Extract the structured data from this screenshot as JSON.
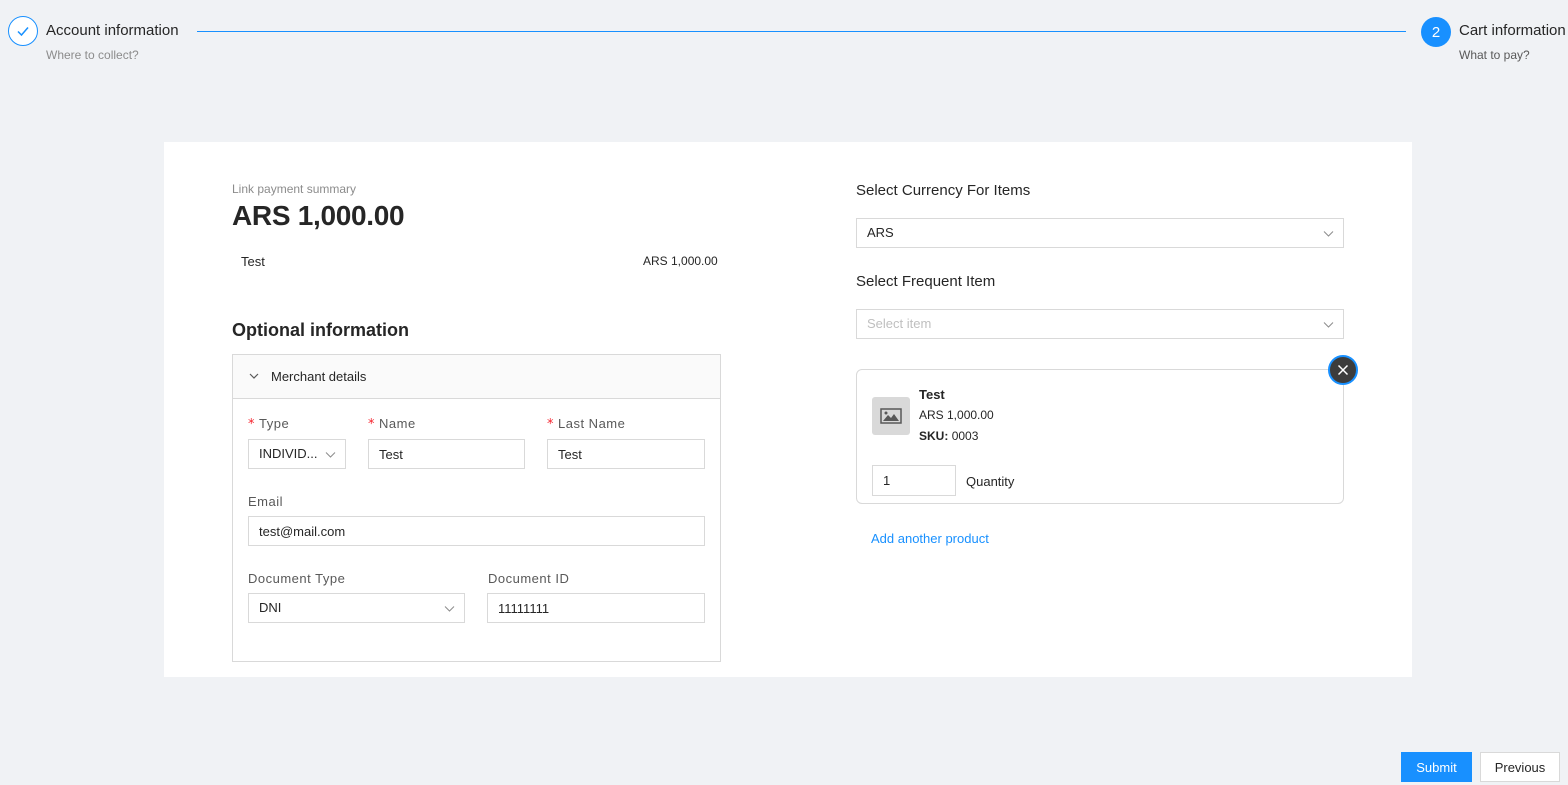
{
  "steps": [
    {
      "title": "Account information",
      "description": "Where to collect?",
      "status": "finished"
    },
    {
      "number": "2",
      "title": "Cart information",
      "description": "What to pay?",
      "status": "current"
    }
  ],
  "summary": {
    "label": "Link payment summary",
    "total": "ARS 1,000.00",
    "items": [
      {
        "name": "Test",
        "price": "ARS 1,000.00"
      }
    ]
  },
  "optional": {
    "title": "Optional information",
    "panel_title": "Merchant details",
    "fields": {
      "type": {
        "label": "Type",
        "value": "INDIVID..."
      },
      "name": {
        "label": "Name",
        "value": "Test"
      },
      "last_name": {
        "label": "Last Name",
        "value": "Test"
      },
      "email": {
        "label": "Email",
        "value": "test@mail.com"
      },
      "document_type": {
        "label": "Document Type",
        "value": "DNI"
      },
      "document_id": {
        "label": "Document ID",
        "value": "11111111"
      }
    }
  },
  "cart": {
    "currency_label": "Select Currency For Items",
    "currency_value": "ARS",
    "frequent_label": "Select Frequent Item",
    "frequent_placeholder": "Select item",
    "product": {
      "name": "Test",
      "price": "ARS 1,000.00",
      "sku_label": "SKU:",
      "sku_value": "0003",
      "quantity": "1",
      "quantity_label": "Quantity"
    },
    "add_product_label": "Add another product"
  },
  "footer": {
    "submit_label": "Submit",
    "previous_label": "Previous"
  },
  "colors": {
    "primary": "#1890ff",
    "required": "#f5222d",
    "background": "#f0f2f5"
  },
  "icons": {
    "step1": "check-icon",
    "collapse": "chevron-down-icon",
    "select": "chevron-down-icon",
    "product": "image-icon",
    "remove": "close-icon"
  }
}
